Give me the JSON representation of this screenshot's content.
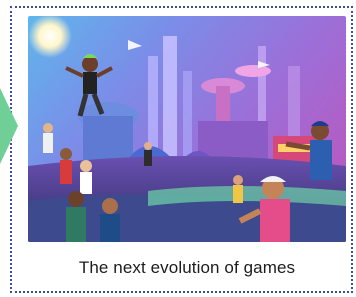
{
  "card": {
    "caption": "The next evolution of games",
    "image_alt": "metaverse-city-artwork"
  },
  "colors": {
    "frame_border": "#3d4f9c",
    "arrow": "#6fcf97",
    "caption_text": "#1c1c1c"
  }
}
